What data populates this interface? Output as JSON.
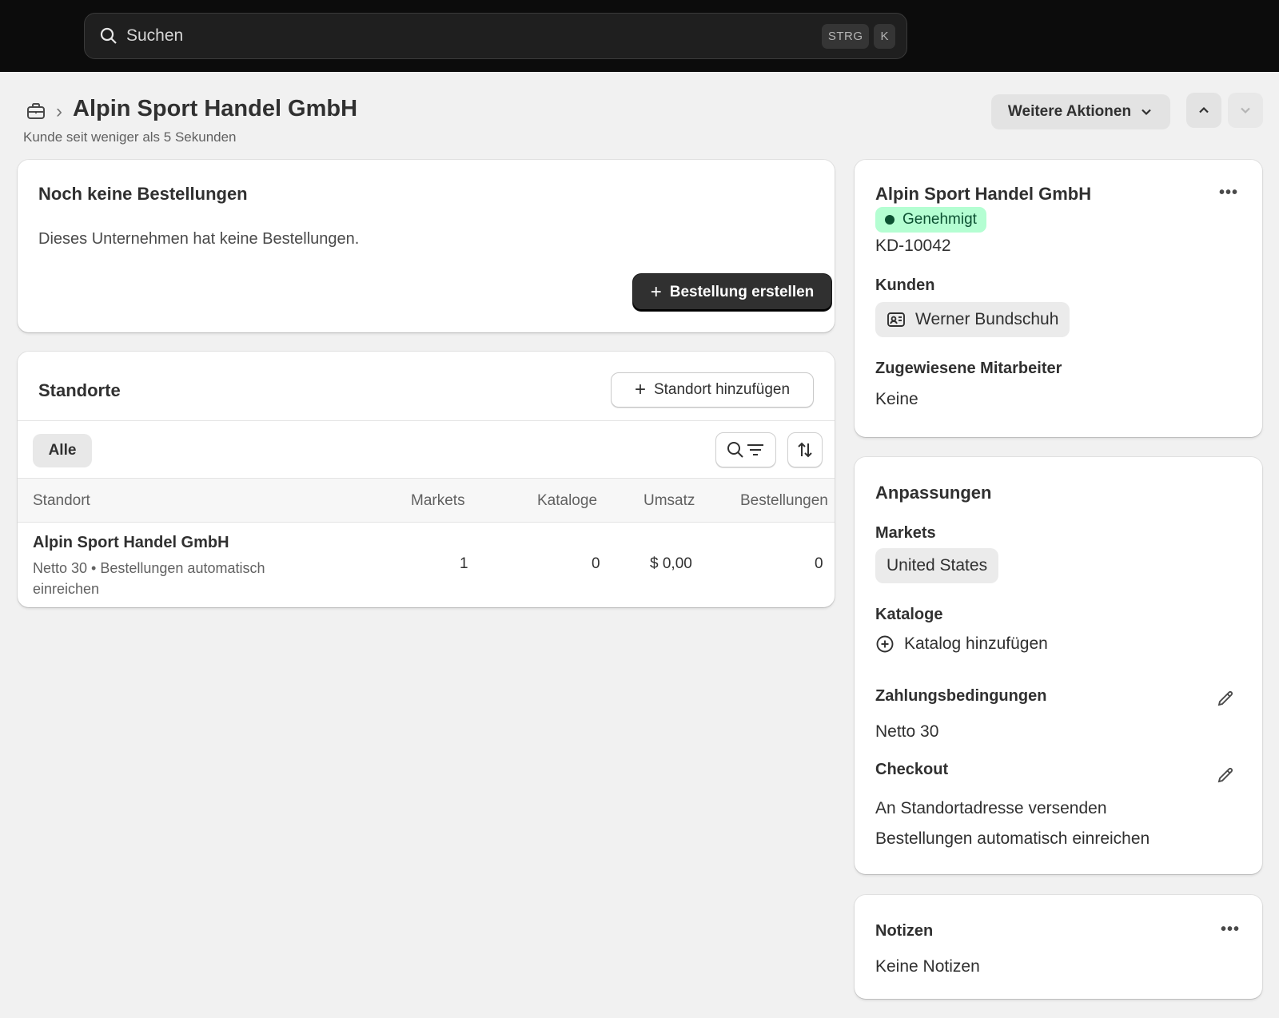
{
  "search": {
    "placeholder": "Suchen",
    "kbd1": "STRG",
    "kbd2": "K"
  },
  "header": {
    "title": "Alpin Sport Handel GmbH",
    "subtitle": "Kunde seit weniger als 5 Sekunden",
    "more_actions": "Weitere Aktionen"
  },
  "orders": {
    "title": "Noch keine Bestellungen",
    "message": "Dieses Unternehmen hat keine Bestellungen.",
    "create_button": "Bestellung erstellen"
  },
  "locations": {
    "title": "Standorte",
    "add_button": "Standort hinzufügen",
    "filter_all": "Alle",
    "columns": [
      "Standort",
      "Markets",
      "Kataloge",
      "Umsatz",
      "Bestellungen"
    ],
    "rows": [
      {
        "name": "Alpin Sport Handel GmbH",
        "sub": "Netto 30 • Bestellungen automatisch einreichen",
        "markets": "1",
        "catalogs": "0",
        "revenue": "$ 0,00",
        "orders": "0"
      }
    ]
  },
  "company": {
    "name": "Alpin Sport Handel GmbH",
    "status": "Genehmigt",
    "id": "KD-10042",
    "customers_label": "Kunden",
    "customer": "Werner Bundschuh",
    "staff_label": "Zugewiesene Mitarbeiter",
    "staff_value": "Keine"
  },
  "settings": {
    "title": "Anpassungen",
    "markets_label": "Markets",
    "market": "United States",
    "catalogs_label": "Kataloge",
    "add_catalog": "Katalog hinzufügen",
    "payment_label": "Zahlungsbedingungen",
    "payment_value": "Netto 30",
    "checkout_label": "Checkout",
    "checkout_line1": "An Standortadresse versenden",
    "checkout_line2": "Bestellungen automatisch einreichen"
  },
  "notes": {
    "title": "Notizen",
    "value": "Keine Notizen"
  },
  "colors": {
    "topbar": "#0c0c0c",
    "badge_bg": "#b4fed2",
    "badge_fg": "#0c5132",
    "primary_button": "#303030"
  }
}
